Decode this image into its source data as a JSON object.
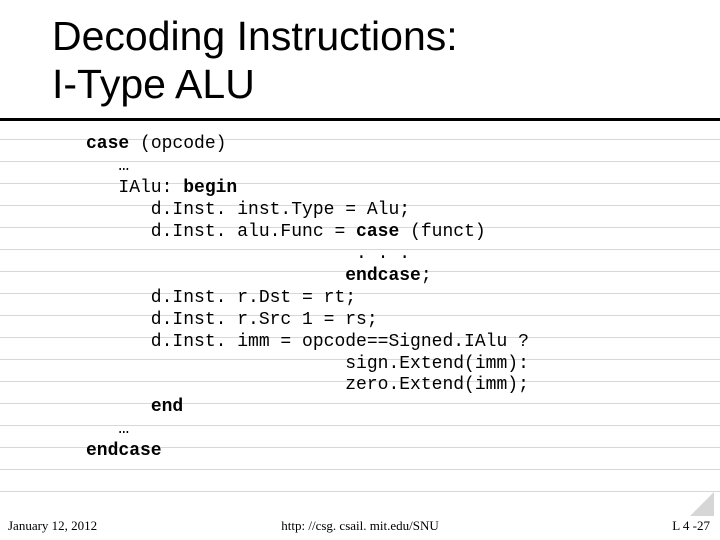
{
  "title": {
    "line1": "Decoding Instructions:",
    "line2": "I-Type ALU"
  },
  "code": {
    "l01a": "case",
    "l01b": " (opcode)",
    "l02": "   …",
    "l03a": "   IAlu: ",
    "l03b": "begin",
    "l04": "      d.Inst. inst.Type = Alu;",
    "l05a": "      d.Inst. alu.Func = ",
    "l05b": "case",
    "l05c": " (funct)",
    "l06": "                         . . .",
    "l07a": "                        ",
    "l07b": "endcase",
    "l07c": ";",
    "l08": "      d.Inst. r.Dst = rt;",
    "l09": "      d.Inst. r.Src 1 = rs;",
    "l10": "      d.Inst. imm = opcode==Signed.IAlu ?",
    "l11": "                        sign.Extend(imm):",
    "l12": "                        zero.Extend(imm);",
    "l13a": "      ",
    "l13b": "end",
    "l14": "   …",
    "l15": "endcase"
  },
  "footer": {
    "date": "January 12, 2012",
    "link": "http: //csg. csail. mit.edu/SNU",
    "page": "L 4 -27"
  }
}
